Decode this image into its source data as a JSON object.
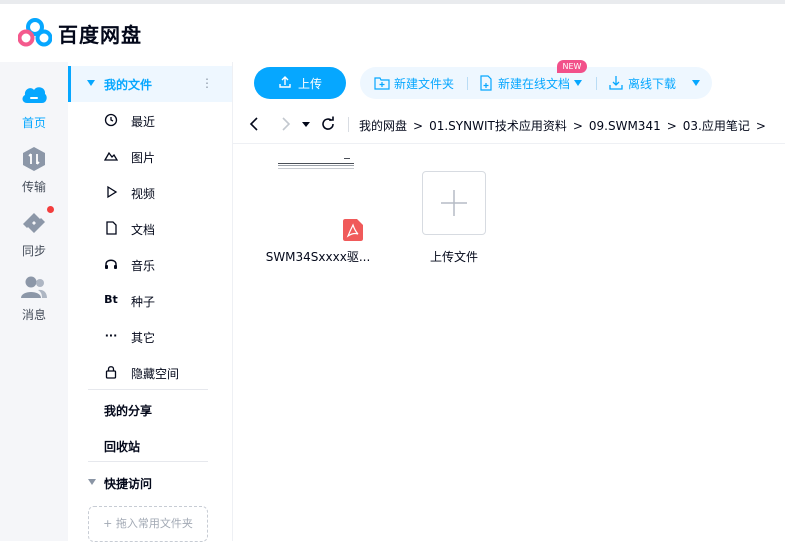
{
  "app": {
    "brand_prefix": "百度",
    "brand_suffix": "网盘"
  },
  "leftnav": {
    "items": [
      {
        "label": "首页",
        "icon": "cloud-home-icon",
        "active": true
      },
      {
        "label": "传输",
        "icon": "transfer-icon",
        "active": false
      },
      {
        "label": "同步",
        "icon": "sync-icon",
        "active": false,
        "badge": true
      },
      {
        "label": "消息",
        "icon": "messages-icon",
        "active": false
      }
    ]
  },
  "sidebar": {
    "my_files": "我的文件",
    "more": "⋮",
    "items": [
      {
        "label": "最近",
        "icon": "clock-icon"
      },
      {
        "label": "图片",
        "icon": "image-icon"
      },
      {
        "label": "视频",
        "icon": "video-icon"
      },
      {
        "label": "文档",
        "icon": "document-icon"
      },
      {
        "label": "音乐",
        "icon": "headphones-icon"
      },
      {
        "label": "种子",
        "icon": "bt-icon",
        "glyph": "Bt"
      },
      {
        "label": "其它",
        "icon": "more-dots-icon",
        "glyph": "···"
      },
      {
        "label": "隐藏空间",
        "icon": "lock-icon"
      }
    ],
    "my_share": "我的分享",
    "recycle_bin": "回收站",
    "quick_access": "快捷访问",
    "drop_hint": "+ 拖入常用文件夹"
  },
  "toolbar": {
    "upload": "上传",
    "new_folder": "新建文件夹",
    "new_online_doc": "新建在线文档",
    "new_badge": "NEW",
    "offline_download": "离线下载"
  },
  "breadcrumb": {
    "items": [
      "我的网盘",
      "01.SYNWIT技术应用资料",
      "09.SWM341",
      "03.应用笔记"
    ],
    "separator": ">"
  },
  "files": [
    {
      "name": "SWM34Sxxxx驱...",
      "type": "pdf"
    }
  ],
  "upload_tile": {
    "label": "上传文件"
  },
  "colors": {
    "accent": "#06a7ff",
    "text": "#03081a",
    "badge_new": "#f2508a",
    "pdf_red": "#f05a5a",
    "notification_dot": "#f33d3d"
  }
}
